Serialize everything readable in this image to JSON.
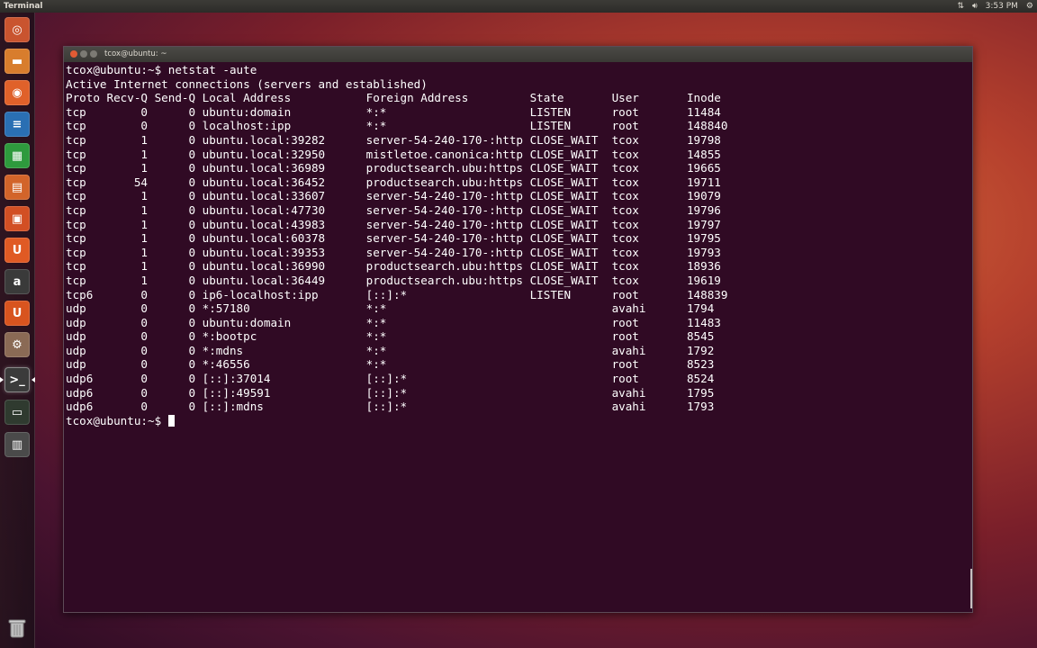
{
  "top_panel": {
    "app_title": "Terminal",
    "time": "3:53 PM"
  },
  "launcher": {
    "items": [
      {
        "name": "dash-home-icon",
        "glyph": "◎",
        "color": "#c9542f"
      },
      {
        "name": "files-icon",
        "glyph": "▬",
        "color": "#d87d2d"
      },
      {
        "name": "firefox-icon",
        "glyph": "◉",
        "color": "#e0612a"
      },
      {
        "name": "writer-icon",
        "glyph": "≡",
        "color": "#2a6fb3"
      },
      {
        "name": "calc-icon",
        "glyph": "▦",
        "color": "#2e9a3d"
      },
      {
        "name": "impress-icon",
        "glyph": "▤",
        "color": "#d2642a"
      },
      {
        "name": "software-center-icon",
        "glyph": "▣",
        "color": "#d24f24"
      },
      {
        "name": "ubuntu-one-icon",
        "glyph": "U",
        "color": "#e05a24"
      },
      {
        "name": "amazon-icon",
        "glyph": "a",
        "color": "#3a3a3a"
      },
      {
        "name": "ubuntu-one-music-icon",
        "glyph": "U",
        "color": "#d8541f"
      },
      {
        "name": "system-settings-icon",
        "glyph": "⚙",
        "color": "#8a6a55"
      },
      {
        "name": "terminal-icon",
        "glyph": ">_",
        "color": "#3b3b3b"
      },
      {
        "name": "terminal-alt-icon",
        "glyph": "▭",
        "color": "#2f3a2f"
      },
      {
        "name": "workspace-switcher-icon",
        "glyph": "▥",
        "color": "#4a4a4a"
      }
    ]
  },
  "window": {
    "title": "tcox@ubuntu: ~"
  },
  "terminal": {
    "lines": [
      "tcox@ubuntu:~$ netstat -aute",
      "Active Internet connections (servers and established)",
      "Proto Recv-Q Send-Q Local Address           Foreign Address         State       User       Inode",
      "tcp        0      0 ubuntu:domain           *:*                     LISTEN      root       11484",
      "tcp        0      0 localhost:ipp           *:*                     LISTEN      root       148840",
      "tcp        1      0 ubuntu.local:39282      server-54-240-170-:http CLOSE_WAIT  tcox       19798",
      "tcp        1      0 ubuntu.local:32950      mistletoe.canonica:http CLOSE_WAIT  tcox       14855",
      "tcp        1      0 ubuntu.local:36989      productsearch.ubu:https CLOSE_WAIT  tcox       19665",
      "tcp       54      0 ubuntu.local:36452      productsearch.ubu:https CLOSE_WAIT  tcox       19711",
      "tcp        1      0 ubuntu.local:33607      server-54-240-170-:http CLOSE_WAIT  tcox       19079",
      "tcp        1      0 ubuntu.local:47730      server-54-240-170-:http CLOSE_WAIT  tcox       19796",
      "tcp        1      0 ubuntu.local:43983      server-54-240-170-:http CLOSE_WAIT  tcox       19797",
      "tcp        1      0 ubuntu.local:60378      server-54-240-170-:http CLOSE_WAIT  tcox       19795",
      "tcp        1      0 ubuntu.local:39353      server-54-240-170-:http CLOSE_WAIT  tcox       19793",
      "tcp        1      0 ubuntu.local:36990      productsearch.ubu:https CLOSE_WAIT  tcox       18936",
      "tcp        1      0 ubuntu.local:36449      productsearch.ubu:https CLOSE_WAIT  tcox       19619",
      "tcp6       0      0 ip6-localhost:ipp       [::]:*                  LISTEN      root       148839",
      "udp        0      0 *:57180                 *:*                                 avahi      1794",
      "udp        0      0 ubuntu:domain           *:*                                 root       11483",
      "udp        0      0 *:bootpc                *:*                                 root       8545",
      "udp        0      0 *:mdns                  *:*                                 avahi      1792",
      "udp        0      0 *:46556                 *:*                                 root       8523",
      "udp6       0      0 [::]:37014              [::]:*                              root       8524",
      "udp6       0      0 [::]:49591              [::]:*                              avahi      1795",
      "udp6       0      0 [::]:mdns               [::]:*                              avahi      1793"
    ],
    "prompt": "tcox@ubuntu:~$ "
  }
}
